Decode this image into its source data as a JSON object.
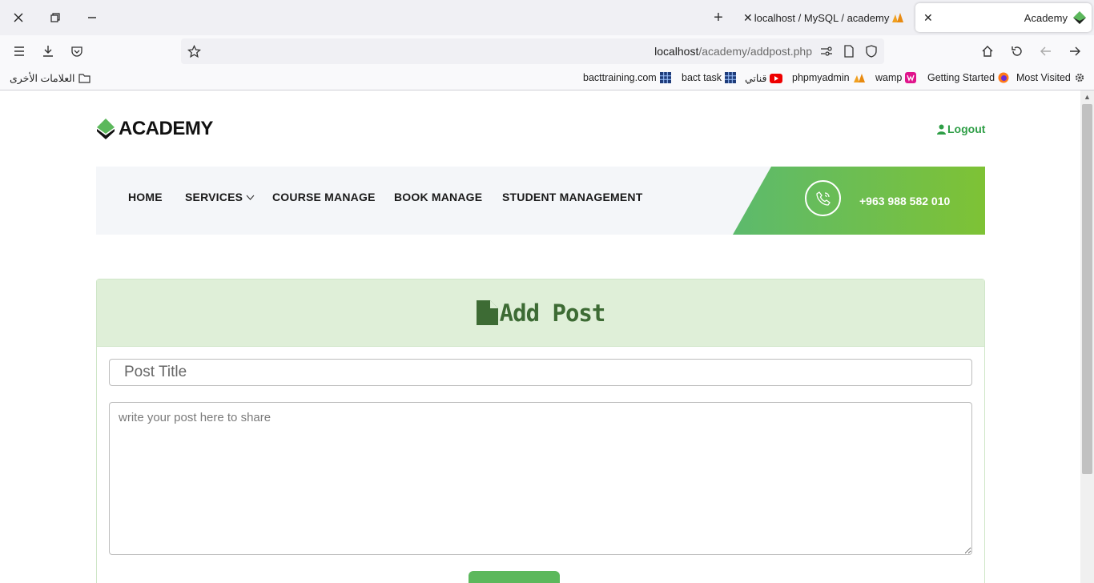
{
  "browser": {
    "tabs": [
      {
        "title": "Academy",
        "active": true
      },
      {
        "title": "localhost / MySQL / academy / ",
        "active": false
      }
    ],
    "url_host": "localhost",
    "url_path": "/academy/addpost.php",
    "bookmarks": [
      {
        "label": "Most Visited",
        "icon": "gear-icon"
      },
      {
        "label": "Getting Started",
        "icon": "firefox-icon"
      },
      {
        "label": "wamp",
        "icon": "wamp-icon"
      },
      {
        "label": "phpmyadmin",
        "icon": "pma-icon"
      },
      {
        "label": "قناتي",
        "icon": "youtube-icon"
      },
      {
        "label": "bact task",
        "icon": "grid-icon"
      },
      {
        "label": "bacttraining.com",
        "icon": "grid-icon"
      }
    ],
    "other_bookmarks": "العلامات الأخرى"
  },
  "site": {
    "logo_text": "ACADEMY",
    "logout_label": "Logout",
    "menu": [
      "HOME",
      "SERVICES",
      "COURSE MANAGE",
      "BOOK MANAGE",
      "STUDENT MANAGEMENT"
    ],
    "phone": "+963 988 582 010"
  },
  "form": {
    "title": "Add Post",
    "post_title_placeholder": "Post Title",
    "post_body_placeholder": "write your post here to share"
  },
  "colors": {
    "brand_green": "#2e9e46",
    "header_green": "#3d6b34",
    "card_header_bg": "#dfefd8",
    "button_green": "#5cb85c"
  }
}
